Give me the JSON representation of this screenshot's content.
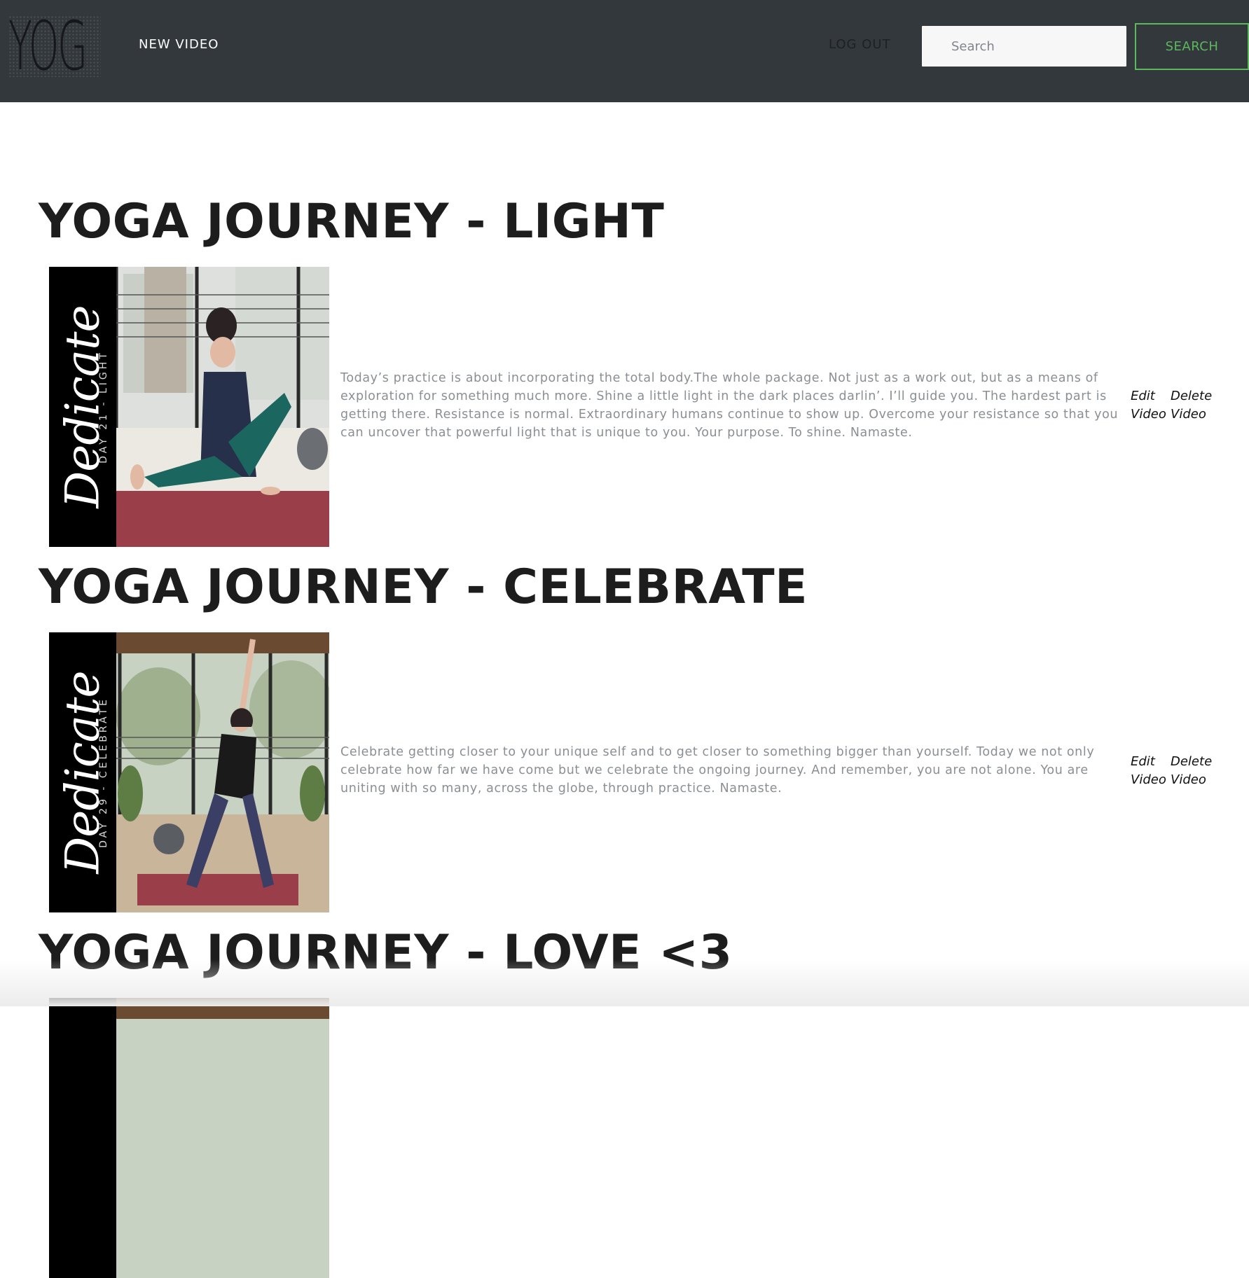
{
  "nav": {
    "logo_text": "YOG",
    "new_video_label": "NEW VIDEO",
    "logout_label": "LOG OUT",
    "search_placeholder": "Search",
    "search_button_label": "SEARCH"
  },
  "colors": {
    "navbar": "#33383c",
    "accent": "#5cb85c",
    "description": "#8a8f94"
  },
  "videos": [
    {
      "title": "YOGA JOURNEY - LIGHT",
      "thumb_script": "Dedicate",
      "thumb_day": "DAY 21 - LIGHT",
      "description": "Today’s practice is about incorporating the total body.The whole package. Not just as a work out, but as a means of exploration for something much more. Shine a little light in the dark places darlin’. I’ll guide you. The hardest part is getting there. Resistance is normal. Extraordinary humans continue to show up. Overcome your resistance so that you can uncover that powerful light that is unique to you. Your purpose. To shine. Namaste.",
      "edit_label": "Edit Video",
      "delete_label": "Delete Video"
    },
    {
      "title": "YOGA JOURNEY - CELEBRATE",
      "thumb_script": "Dedicate",
      "thumb_day": "DAY 29 - CELEBRATE",
      "description": "Celebrate getting closer to your unique self and to get closer to something bigger than yourself. Today we not only celebrate how far we have come but we celebrate the ongoing journey. And remember, you are not alone. You are uniting with so many, across the globe, through practice. Namaste.",
      "edit_label": "Edit Video",
      "delete_label": "Delete Video"
    },
    {
      "title": "YOGA JOURNEY - LOVE <3"
    }
  ]
}
